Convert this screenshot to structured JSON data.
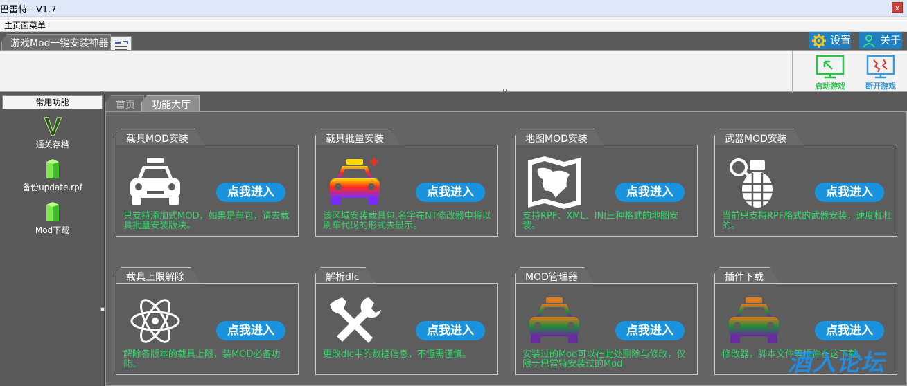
{
  "window": {
    "title": "巴雷特 - V1.7",
    "close": "x"
  },
  "menu": {
    "main_menu": "主页面菜单"
  },
  "top_tab": {
    "label": "游戏Mod一键安装神器"
  },
  "top_buttons": {
    "settings": "设置",
    "about": "关于"
  },
  "game_buttons": {
    "launch": "启动游戏",
    "disconnect": "断开游戏"
  },
  "left_panel": {
    "header": "常用功能",
    "items": [
      {
        "label": "通关存档",
        "icon": "gta-v-logo-icon"
      },
      {
        "label": "备份update.rpf",
        "icon": "green-gem-icon"
      },
      {
        "label": "Mod下载",
        "icon": "green-gem-icon"
      }
    ]
  },
  "content_tabs": {
    "home": "首页",
    "hall": "功能大厅"
  },
  "cards": [
    {
      "title": "载具MOD安装",
      "button": "点我进入",
      "desc": "只支持添加式MOD，如果是车包，请去载具批量安装版块。",
      "icon": "white-car-icon"
    },
    {
      "title": "载具批量安装",
      "button": "点我进入",
      "desc": "该区域安装载具包,名字在NT修改器中将以刷车代码的形式去显示。",
      "icon": "rainbow-car-plus-icon"
    },
    {
      "title": "地图MOD安装",
      "button": "点我进入",
      "desc": "支持RPF、XML、INI三种格式的地图安装。",
      "icon": "map-icon"
    },
    {
      "title": "武器MOD安装",
      "button": "点我进入",
      "desc": "当前只支持RPF格式的武器安装，速度杠杠的。",
      "icon": "grenade-icon"
    },
    {
      "title": "载具上限解除",
      "button": "点我进入",
      "desc": "解除各版本的载具上限，装MOD必备功能。",
      "icon": "atom-icon"
    },
    {
      "title": "解析dlc",
      "button": "点我进入",
      "desc": "更改dlc中的数据信息，不懂需谨慎。",
      "icon": "tools-icon"
    },
    {
      "title": "MOD管理器",
      "button": "点我进入",
      "desc": "安装过的Mod可以在此处删除与修改，仅限于巴雷特安装过的Mod",
      "icon": "gradient-car-icon"
    },
    {
      "title": "插件下载",
      "button": "点我进入",
      "desc": "修改器，脚本文件等插件在这下载。",
      "icon": "gradient-car-icon"
    }
  ],
  "watermark": "酒入论坛",
  "colors": {
    "accent_blue": "#1a93df",
    "desc_green": "#33d66a",
    "launch_green": "#2fc24a",
    "disconnect_blue": "#3a9ad8"
  }
}
